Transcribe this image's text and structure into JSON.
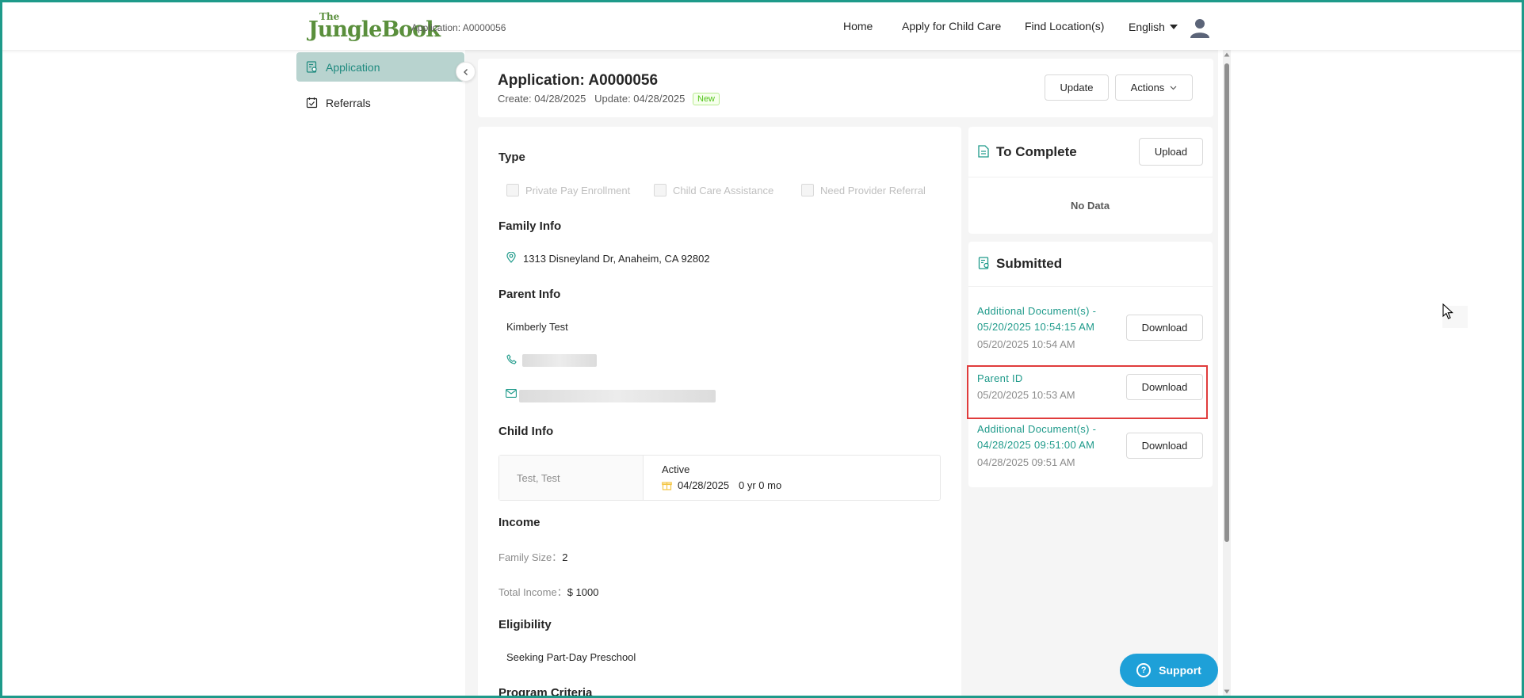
{
  "header": {
    "logo_the": "The",
    "logo_name": "JungleBook",
    "app_id": "Application: A0000056",
    "nav": [
      "Home",
      "Apply for Child Care",
      "Find Location(s)"
    ],
    "language": "English"
  },
  "sidebar": {
    "items": [
      {
        "label": "Application",
        "active": true
      },
      {
        "label": "Referrals",
        "active": false
      }
    ]
  },
  "application": {
    "title": "Application: A0000056",
    "create_label": "Create: 04/28/2025",
    "update_label": "Update: 04/28/2025",
    "status_tag": "New",
    "update_button": "Update",
    "actions_button": "Actions"
  },
  "type": {
    "title": "Type",
    "options": [
      "Private Pay Enrollment",
      "Child Care Assistance",
      "Need Provider Referral"
    ]
  },
  "family": {
    "title": "Family Info",
    "address": "1313 Disneyland Dr, Anaheim, CA 92802"
  },
  "parent": {
    "title": "Parent Info",
    "name": "Kimberly Test"
  },
  "child": {
    "title": "Child Info",
    "name": "Test, Test",
    "status": "Active",
    "birthdate": "04/28/2025",
    "age": "0 yr 0 mo"
  },
  "income": {
    "title": "Income",
    "family_size_label": "Family Size：",
    "family_size": "2",
    "total_income_label": "Total Income：",
    "total_income": "$ 1000"
  },
  "eligibility": {
    "title": "Eligibility",
    "value": "Seeking Part-Day Preschool"
  },
  "program_criteria": {
    "title": "Program Criteria"
  },
  "to_complete": {
    "title": "To Complete",
    "upload_button": "Upload",
    "empty": "No Data"
  },
  "submitted": {
    "title": "Submitted",
    "download_label": "Download",
    "items": [
      {
        "line1": "Additional Document(s) -",
        "line2": "05/20/2025 10:54:15 AM",
        "date": "05/20/2025 10:54 AM"
      },
      {
        "line1": "Parent ID",
        "line2": "",
        "date": "05/20/2025 10:53 AM"
      },
      {
        "line1": "Additional Document(s) -",
        "line2": "04/28/2025 09:51:00 AM",
        "date": "04/28/2025 09:51 AM"
      }
    ]
  },
  "support": {
    "label": "Support"
  },
  "colors": {
    "accent": "#1e9a8a",
    "highlight": "#e03c3c",
    "support": "#1ea0d8"
  }
}
